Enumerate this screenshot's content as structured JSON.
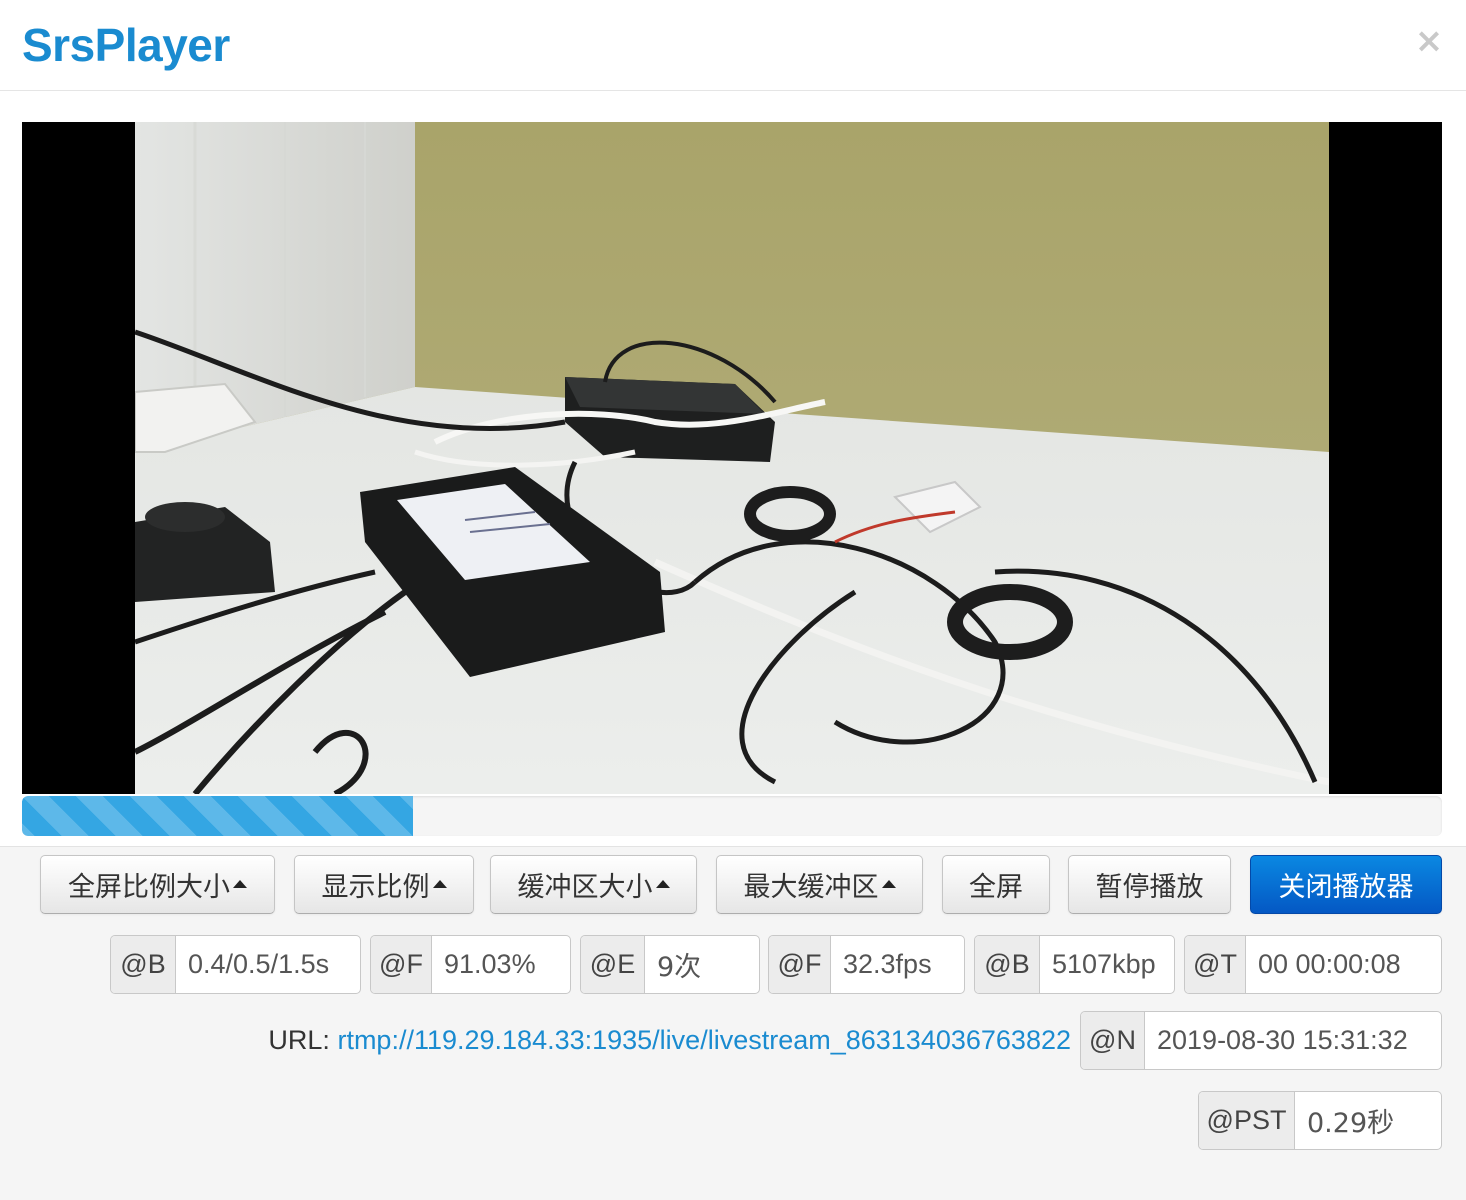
{
  "title": "SrsPlayer",
  "close_icon": "×",
  "progress": {
    "fraction": 0.275
  },
  "buttons": {
    "fullscreen_ratio": "全屏比例大小",
    "display_ratio": "显示比例",
    "buffer_size": "缓冲区大小",
    "max_buffer": "最大缓冲区",
    "fullscreen": "全屏",
    "pause": "暂停播放",
    "close_player": "关闭播放器"
  },
  "stats": [
    {
      "label": "@B",
      "value": "0.4/0.5/1.5s"
    },
    {
      "label": "@F",
      "value": "91.03%"
    },
    {
      "label": "@E",
      "value": "9次"
    },
    {
      "label": "@F",
      "value": "32.3fps"
    },
    {
      "label": "@B",
      "value": "5107kbp"
    },
    {
      "label": "@T",
      "value": "00 00:00:08"
    }
  ],
  "url": {
    "label": "URL:",
    "link": "rtmp://119.29.184.33:1935/live/livestream_863134036763822"
  },
  "now": {
    "label": "@N",
    "value": "2019-08-30 15:31:32"
  },
  "pst": {
    "label": "@PST",
    "value": "0.29秒"
  }
}
